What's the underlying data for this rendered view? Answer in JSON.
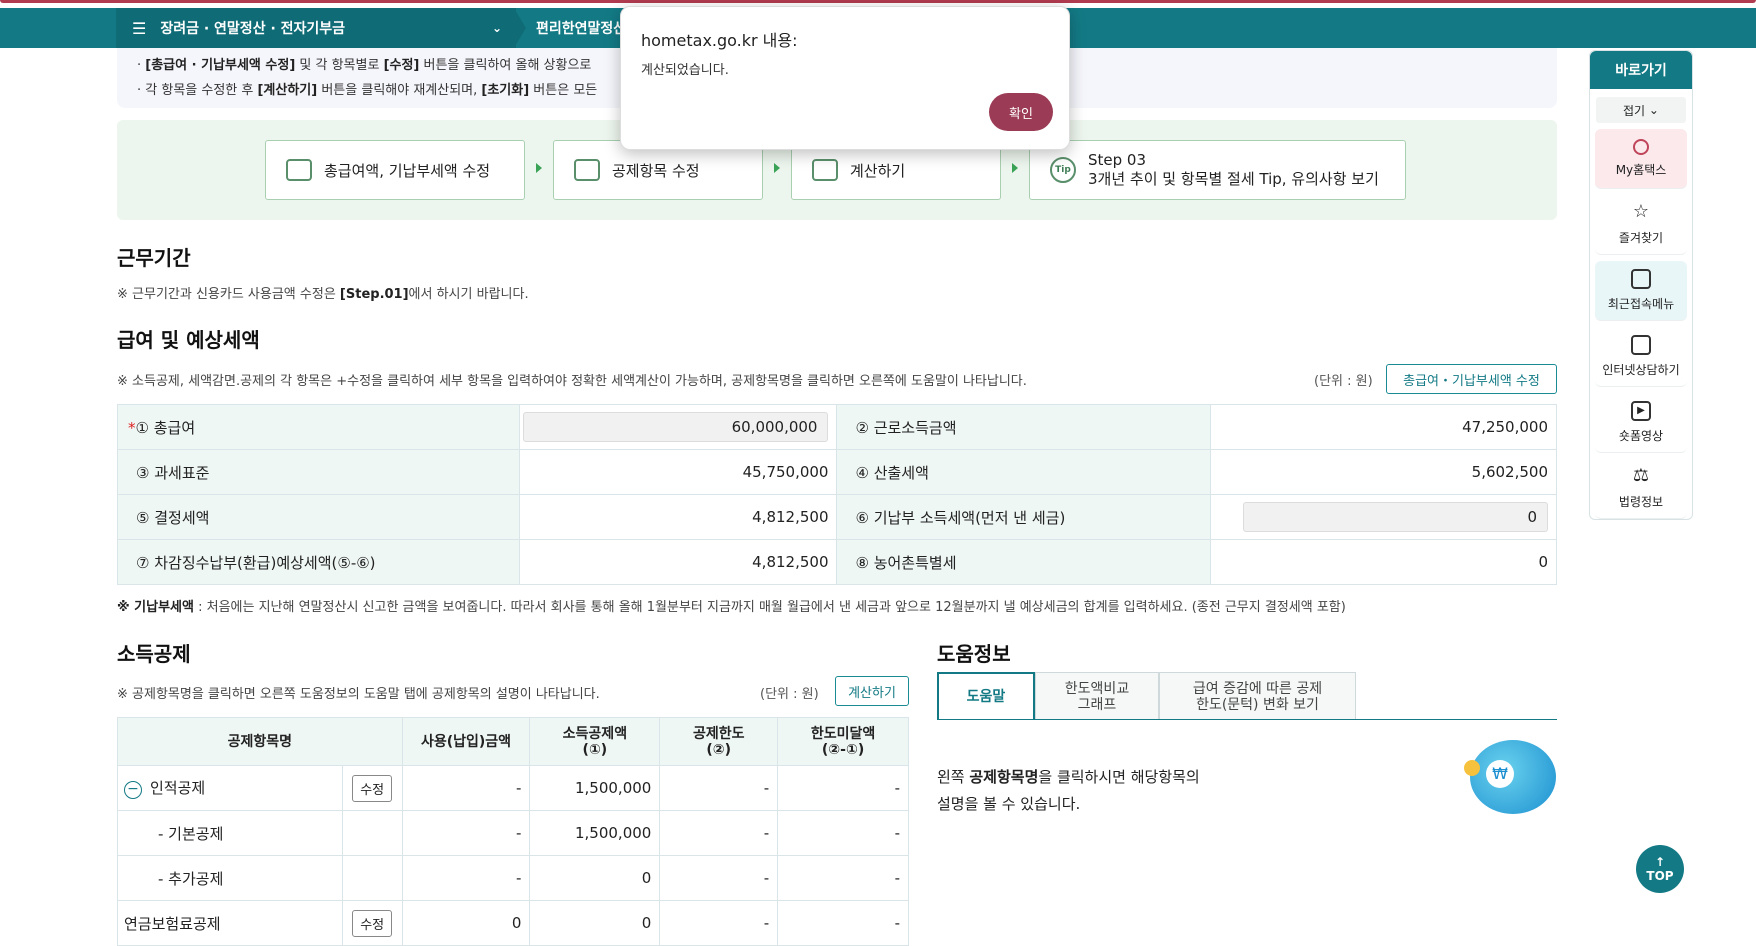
{
  "nav": {
    "main_menu": "장려금 · 연말정산 · 전자기부금",
    "sub_menu": "편리한연말정산"
  },
  "info": {
    "line1_prefix": "[총급여 · 기납부세액 수정]",
    "line1_rest": " 및 각 항목별로 ",
    "line1_edit": "[수정]",
    "line1_tail": " 버튼을 클릭하여 올해 상황으로",
    "line2_a": "각 항목을 수정한 후 ",
    "line2_calc": "[계산하기]",
    "line2_b": " 버튼을 클릭해야 재계산되며, ",
    "line2_reset": "[초기화]",
    "line2_c": " 버튼은 모든"
  },
  "steps": {
    "s1": "총급여액, 기납부세액 수정",
    "s2": "공제항목 수정",
    "s3": "계산하기",
    "s4_title": "Step 03",
    "s4_desc": "3개년 추이 및 항목별 절세 Tip, 유의사항 보기",
    "tip_label": "Tip"
  },
  "work_period": {
    "title": "근무기간",
    "note_a": "※ 근무기간과 신용카드 사용금액 수정은 ",
    "note_b": "[Step.01]",
    "note_c": "에서 하시기 바랍니다."
  },
  "salary": {
    "title": "급여 및 예상세액",
    "note": "※ 소득공제, 세액감면.공제의 각 항목은 +수정을 클릭하여 세부 항목을 입력하여야 정확한 세액계산이 가능하며, 공제항목명을 클릭하면 오른쪽에 도움말이 나타납니다.",
    "unit": "(단위 : 원)",
    "edit_button": "총급여・기납부세액 수정",
    "rows": [
      {
        "l1": "① 총급여",
        "v1": "60,000,000",
        "l2": "② 근로소득금액",
        "v2": "47,250,000"
      },
      {
        "l1": "③ 과세표준",
        "v1": "45,750,000",
        "l2": "④ 산출세액",
        "v2": "5,602,500"
      },
      {
        "l1": "⑤ 결정세액",
        "v1": "4,812,500",
        "l2": "⑥ 기납부 소득세액(먼저 낸 세금)",
        "v2": "0"
      },
      {
        "l1": "⑦ 차감징수납부(환급)예상세액(⑤-⑥)",
        "v1": "4,812,500",
        "l2": "⑧ 농어촌특별세",
        "v2": "0"
      }
    ],
    "footnote_b": "※ 기납부세액",
    "footnote": " : 처음에는 지난해 연말정산시 신고한 금액을 보여줍니다. 따라서 회사를 통해 올해 1월분부터 지금까지 매월 월급에서 낸 세금과 앞으로 12월분까지 낼 예상세금의 합계를 입력하세요. (종전 근무지 결정세액 포함)"
  },
  "deduction": {
    "title": "소득공제",
    "note": "※ 공제항목명을 클릭하면 오른쪽 도움정보의 도움말 탭에 공제항목의 설명이 나타납니다.",
    "unit": "(단위 : 원)",
    "calc_button": "계산하기",
    "headers": {
      "name": "공제항목명",
      "used": "사용(납입)금액",
      "amount_1": "소득공제액",
      "amount_2": "(①)",
      "limit_1": "공제한도",
      "limit_2": "(②)",
      "shortfall_1": "한도미달액",
      "shortfall_2": "(②-①)"
    },
    "edit_label": "수정",
    "rows": [
      {
        "name": "인적공제",
        "used": "-",
        "amount": "1,500,000",
        "limit": "-",
        "short": "-"
      },
      {
        "name": "- 기본공제",
        "used": "-",
        "amount": "1,500,000",
        "limit": "-",
        "short": "-"
      },
      {
        "name": "- 추가공제",
        "used": "-",
        "amount": "0",
        "limit": "-",
        "short": "-"
      },
      {
        "name": "연금보험료공제",
        "used": "0",
        "amount": "0",
        "limit": "-",
        "short": "-"
      }
    ]
  },
  "help": {
    "title": "도움정보",
    "tab1": "도움말",
    "tab2_a": "한도액비교",
    "tab2_b": "그래프",
    "tab3_a": "급여 증감에 따른 공제",
    "tab3_b": "한도(문턱) 변화 보기",
    "text_a": "왼쪽 ",
    "text_b": "공제항목명",
    "text_c": "을 클릭하시면 해당항목의",
    "text_d": "설명을 볼 수 있습니다."
  },
  "quick": {
    "title": "바로가기",
    "fold": "접기",
    "items": [
      "My홈택스",
      "즐겨찾기",
      "최근접속메뉴",
      "인터넷상담하기",
      "숏폼영상",
      "법령정보"
    ]
  },
  "dialog": {
    "title": "hometax.go.kr 내용:",
    "message": "계산되었습니다.",
    "ok": "확인"
  },
  "top_button": "TOP"
}
